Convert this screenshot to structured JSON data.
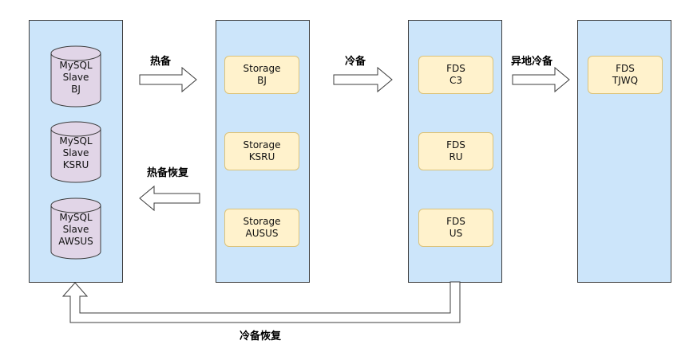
{
  "colors": {
    "column_fill": "#cce5fa",
    "node_fill": "#fff2cc",
    "db_fill": "#e1d5e7",
    "stroke": "#3c3c3c"
  },
  "mysql_slaves": [
    {
      "line1": "MySQL",
      "line2": "Slave",
      "line3": "BJ"
    },
    {
      "line1": "MySQL",
      "line2": "Slave",
      "line3": "KSRU"
    },
    {
      "line1": "MySQL",
      "line2": "Slave",
      "line3": "AWSUS"
    }
  ],
  "storage_nodes": [
    {
      "line1": "Storage",
      "line2": "BJ"
    },
    {
      "line1": "Storage",
      "line2": "KSRU"
    },
    {
      "line1": "Storage",
      "line2": "AUSUS"
    }
  ],
  "fds_nodes": [
    {
      "line1": "FDS",
      "line2": "C3"
    },
    {
      "line1": "FDS",
      "line2": "RU"
    },
    {
      "line1": "FDS",
      "line2": "US"
    }
  ],
  "remote_node": {
    "line1": "FDS",
    "line2": "TJWQ"
  },
  "labels": {
    "hot_backup": "热备",
    "cold_backup": "冷备",
    "offsite_cold_backup": "异地冷备",
    "hot_restore": "热备恢复",
    "cold_restore": "冷备恢复"
  }
}
